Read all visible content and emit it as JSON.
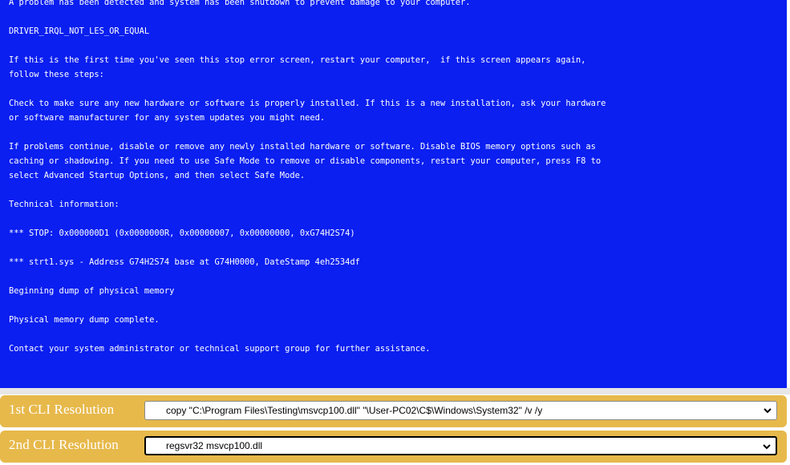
{
  "bsod": {
    "lines": [
      "A problem has been detected and system has been shutdown to prevent damage to your computer.",
      "",
      "DRIVER_IRQL_NOT_LES_OR_EQUAL",
      "",
      "If this is the first time you've seen this stop error screen, restart your computer,  if this screen appears again,",
      "follow these steps:",
      "",
      "Check to make sure any new hardware or software is properly installed. If this is a new installation, ask your hardware",
      "or software manufacturer for any system updates you might need.",
      "",
      "If problems continue, disable or remove any newly installed hardware or software. Disable BIOS memory options such as",
      "caching or shadowing. If you need to use Safe Mode to remove or disable components, restart your computer, press F8 to",
      "select Advanced Startup Options, and then select Safe Mode.",
      "",
      "Technical information:",
      "",
      "*** STOP: 0x000000D1 (0x0000000R, 0x00000007, 0x00000000, 0xG74H2S74)",
      "",
      "*** strt1.sys - Address G74H2S74 base at G74H0000, DateStamp 4eh2534df",
      "",
      "Beginning dump of physical memory",
      "",
      "Physical memory dump complete.",
      "",
      "Contact your system administrator or technical support group for further assistance."
    ]
  },
  "cli": {
    "row1": {
      "label": "1st CLI Resolution",
      "selected": "copy \"C:\\Program Files\\Testing\\msvcp100.dll\" \"\\User-PC02\\C$\\Windows\\System32\" /v /y"
    },
    "row2": {
      "label": "2nd CLI Resolution",
      "selected": "regsvr32 msvcp100.dll"
    }
  },
  "colors": {
    "bsod_bg": "#0a1ff0",
    "row_bg": "#e7b94b"
  },
  "icons": {
    "dropdown": "chevron-down-icon"
  }
}
